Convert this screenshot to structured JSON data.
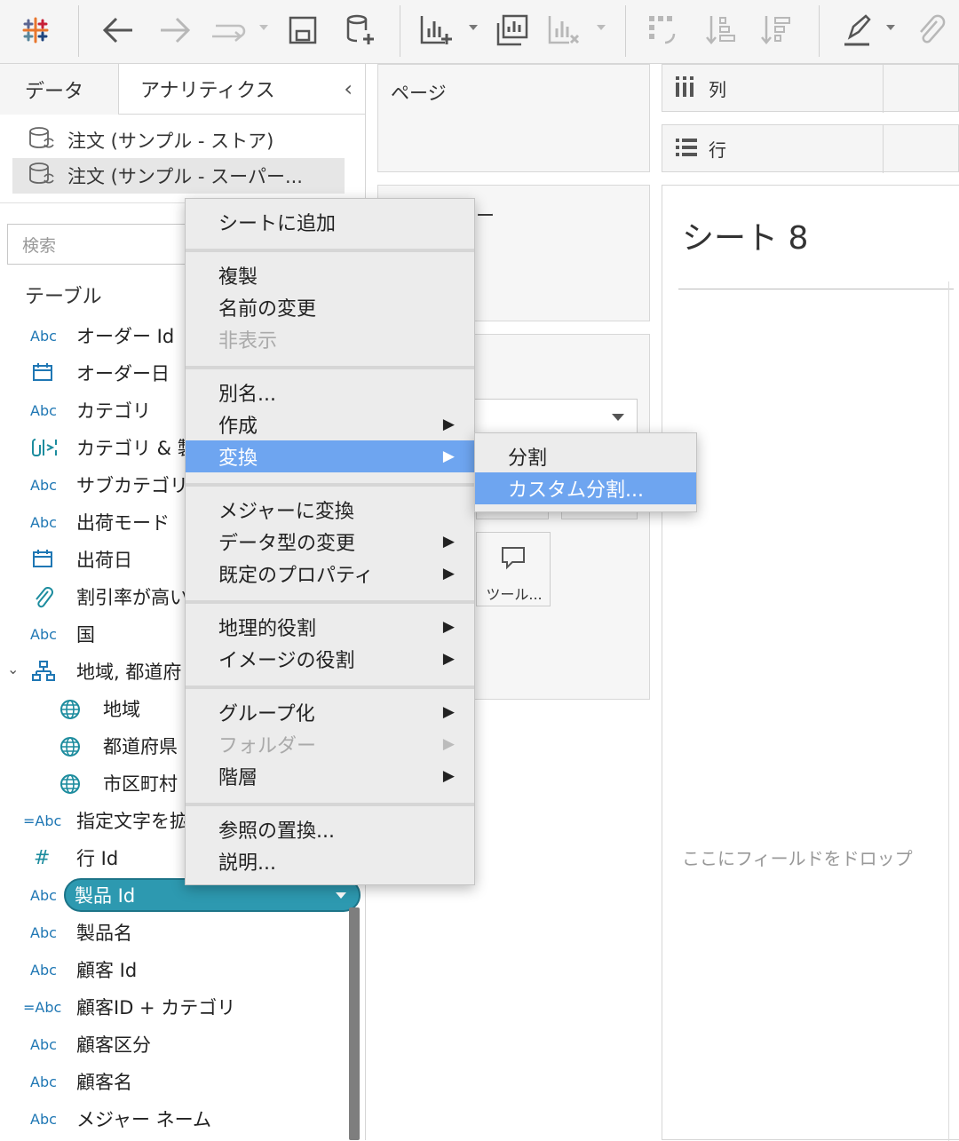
{
  "colors": {
    "accent": "#1c8c9e",
    "menu_highlight": "#6ea5f0",
    "pill": "#2d99b0"
  },
  "toolbar": {
    "icons": [
      "tableau-logo-icon",
      "back-icon",
      "forward-icon",
      "redo-icon",
      "save-icon",
      "new-datasource-icon",
      "new-worksheet-icon",
      "duplicate-sheet-icon",
      "clear-sheet-icon",
      "swap-icon",
      "sort-asc-icon",
      "sort-desc-icon",
      "highlight-icon",
      "attach-icon"
    ]
  },
  "left": {
    "tabs": {
      "data": "データ",
      "analytics": "アナリティクス"
    },
    "datasources": [
      "注文 (サンプル - ストア)",
      "注文 (サンプル - スーパー..."
    ],
    "search_placeholder": "検索",
    "section_title": "テーブル",
    "fields": [
      {
        "type": "Abc",
        "label": "オーダー Id"
      },
      {
        "type": "date-icon",
        "label": "オーダー日"
      },
      {
        "type": "Abc",
        "label": "カテゴリ"
      },
      {
        "type": "combined-icon",
        "label": "カテゴリ & 製"
      },
      {
        "type": "Abc",
        "label": "サブカテゴリ"
      },
      {
        "type": "Abc",
        "label": "出荷モード"
      },
      {
        "type": "date-icon",
        "label": "出荷日"
      },
      {
        "type": "clip-icon",
        "label": "割引率が高い"
      },
      {
        "type": "Abc",
        "label": "国"
      },
      {
        "type": "hierarchy-icon",
        "label": "地域, 都道府"
      },
      {
        "type": "globe-icon",
        "label": "地域"
      },
      {
        "type": "globe-icon",
        "label": "都道府県"
      },
      {
        "type": "globe-icon",
        "label": "市区町村"
      },
      {
        "type": "=Abc",
        "label": "指定文字を拡"
      },
      {
        "type": "#",
        "label": "行 Id"
      },
      {
        "type": "Abc",
        "label": "製品 Id"
      },
      {
        "type": "Abc",
        "label": "製品名"
      },
      {
        "type": "Abc",
        "label": "顧客 Id"
      },
      {
        "type": "=Abc",
        "label": "顧客ID + カテゴリ"
      },
      {
        "type": "Abc",
        "label": "顧客区分"
      },
      {
        "type": "Abc",
        "label": "顧客名"
      },
      {
        "type": "Abc",
        "label": "メジャー ネーム"
      }
    ]
  },
  "middle": {
    "pages_label": "ページ",
    "filters_label_tail": "ー",
    "tooltip_label": "ツール..."
  },
  "right": {
    "columns_label": "列",
    "rows_label": "行",
    "sheet_title": "シート 8",
    "drop_hint": "ここにフィールドをドロップ"
  },
  "menu": {
    "items": [
      {
        "label": "シートに追加"
      },
      {
        "label": "複製"
      },
      {
        "label": "名前の変更"
      },
      {
        "label": "非表示"
      },
      {
        "label": "別名..."
      },
      {
        "label": "作成"
      },
      {
        "label": "変換"
      },
      {
        "label": "メジャーに変換"
      },
      {
        "label": "データ型の変更"
      },
      {
        "label": "既定のプロパティ"
      },
      {
        "label": "地理的役割"
      },
      {
        "label": "イメージの役割"
      },
      {
        "label": "グループ化"
      },
      {
        "label": "フォルダー"
      },
      {
        "label": "階層"
      },
      {
        "label": "参照の置換..."
      },
      {
        "label": "説明..."
      }
    ],
    "arrow_glyph": "▶"
  },
  "submenu": {
    "items": [
      {
        "label": "分割"
      },
      {
        "label": "カスタム分割..."
      }
    ]
  }
}
